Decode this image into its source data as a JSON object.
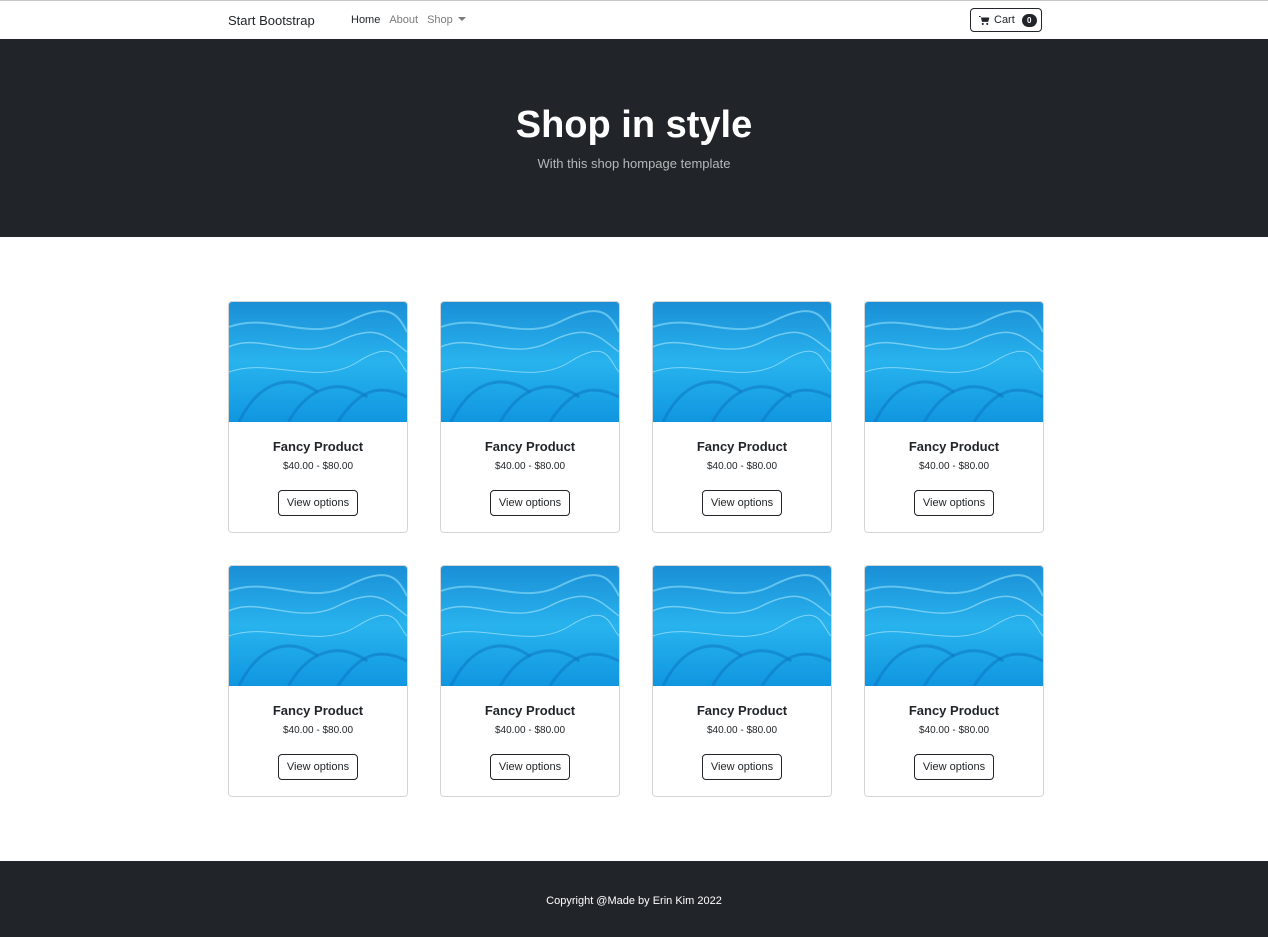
{
  "navbar": {
    "brand": "Start Bootstrap",
    "links": [
      {
        "label": "Home"
      },
      {
        "label": "About"
      },
      {
        "label": "Shop"
      }
    ],
    "cart": {
      "label": "Cart",
      "count": "0"
    }
  },
  "hero": {
    "title": "Shop in style",
    "subtitle": "With this shop hompage template"
  },
  "products": [
    {
      "name": "Fancy Product",
      "price": "$40.00 - $80.00",
      "button": "View options"
    },
    {
      "name": "Fancy Product",
      "price": "$40.00 - $80.00",
      "button": "View options"
    },
    {
      "name": "Fancy Product",
      "price": "$40.00 - $80.00",
      "button": "View options"
    },
    {
      "name": "Fancy Product",
      "price": "$40.00 - $80.00",
      "button": "View options"
    },
    {
      "name": "Fancy Product",
      "price": "$40.00 - $80.00",
      "button": "View options"
    },
    {
      "name": "Fancy Product",
      "price": "$40.00 - $80.00",
      "button": "View options"
    },
    {
      "name": "Fancy Product",
      "price": "$40.00 - $80.00",
      "button": "View options"
    },
    {
      "name": "Fancy Product",
      "price": "$40.00 - $80.00",
      "button": "View options"
    }
  ],
  "footer": {
    "copyright": "Copyright @Made by Erin Kim 2022"
  },
  "colors": {
    "dark": "#212529",
    "image_blue": "#1aa3e8"
  }
}
